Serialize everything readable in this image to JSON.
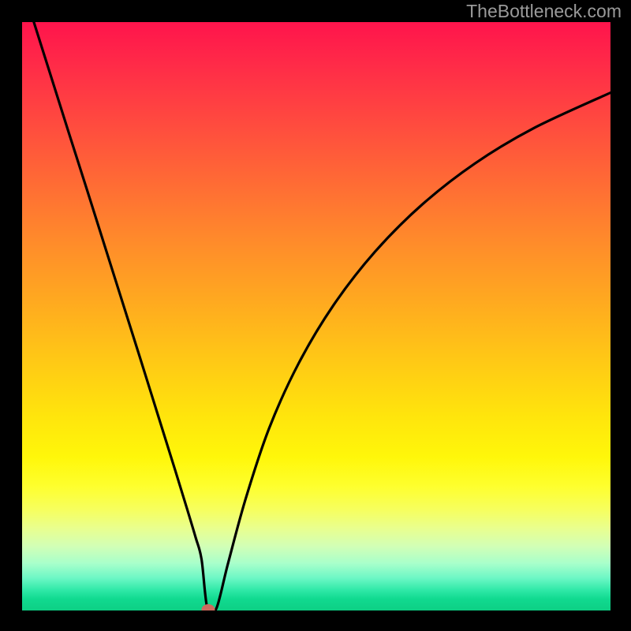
{
  "watermark": "TheBottleneck.com",
  "marker": {
    "x_pct": 31.6,
    "y_pct": 99.9
  },
  "colors": {
    "frame": "#000000",
    "curve": "#000000",
    "marker": "#cd6b5e",
    "gradient_top": "#ff144c",
    "gradient_bottom": "#0dcf84",
    "watermark": "#9a9a9a"
  },
  "chart_data": {
    "type": "line",
    "title": "",
    "xlabel": "",
    "ylabel": "",
    "xlim": [
      0,
      100
    ],
    "ylim": [
      0,
      100
    ],
    "grid": false,
    "legend": false,
    "series": [
      {
        "name": "bottleneck-curve",
        "x": [
          2,
          5,
          8,
          11,
          14,
          17,
          20,
          23,
          26,
          28,
          29.5,
          30.5,
          31.5,
          33,
          35,
          38,
          42,
          47,
          53,
          60,
          68,
          77,
          87,
          100
        ],
        "y": [
          100,
          90.5,
          81,
          71.6,
          62.1,
          52.6,
          43.1,
          33.5,
          23.9,
          17.4,
          12.4,
          8.7,
          0.3,
          0.3,
          8.0,
          19.0,
          31.0,
          42.0,
          52.0,
          61.0,
          69.0,
          76.0,
          82.0,
          88.0
        ]
      }
    ],
    "marker_point": {
      "x": 31.6,
      "y": 0.3
    },
    "notes": "x/y are percentages of the plot area; y increases upward. Background encodes the same metric via color (red high → green low)."
  }
}
